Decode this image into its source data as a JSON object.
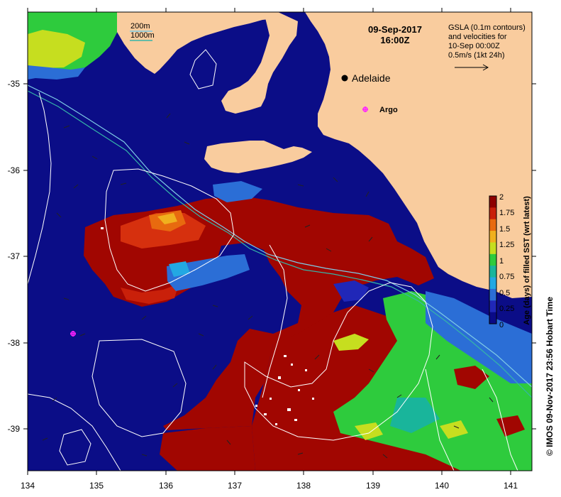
{
  "title": {
    "date": "09-Sep-2017",
    "time": "16:00Z"
  },
  "depth_legend": {
    "contour_1": "200m",
    "contour_2": "1000m",
    "colors": {
      "contour_1": "#7ecbe6",
      "contour_2": "#35b5a8"
    }
  },
  "gsla_note": {
    "line1": "GSLA (0.1m contours)",
    "line2": "and velocities for",
    "line3": "10-Sep 00:00Z",
    "line4": "0.5m/s (1kt 24h)"
  },
  "places": [
    {
      "name": "Adelaide",
      "marker": "black-dot",
      "lon": 138.6,
      "lat": -34.93
    },
    {
      "name": "Argo",
      "marker": "magenta-star",
      "lon": 138.9,
      "lat": -35.27
    }
  ],
  "argo_floats": [
    {
      "lon": 138.9,
      "lat": -35.27,
      "labeled": true
    },
    {
      "lon": 134.65,
      "lat": -37.9,
      "labeled": false
    }
  ],
  "axes": {
    "lon_min": 134.0,
    "lon_max": 141.3,
    "lat_max": -34.4,
    "lat_min": -39.48,
    "x_ticks": [
      "134",
      "135",
      "136",
      "137",
      "138",
      "139",
      "140",
      "141"
    ],
    "y_ticks": [
      "-35",
      "-36",
      "-37",
      "-38",
      "-39"
    ]
  },
  "colorbar": {
    "label": "Age (days) of filled SST (wrt latest)",
    "tick_labels": [
      "2",
      "1.75",
      "1.5",
      "1.25",
      "1",
      "0.75",
      "0.5",
      "0.25",
      "0"
    ],
    "min": 0,
    "max": 2,
    "colors_top_to_bottom": [
      "#8e0000",
      "#c9200a",
      "#e86a0f",
      "#f0b01e",
      "#c6de1f",
      "#2ecb3d",
      "#19b59b",
      "#23a8e3",
      "#2b6ed6",
      "#2027b8",
      "#0a0a87"
    ]
  },
  "credit": "© IMOS 09-Nov-2017 23:56 Hobart Time",
  "colors": {
    "land": "#f9cc9e",
    "sea_old": "#0b0d87",
    "sea_recent": "#a10601",
    "contour": "#ffffff"
  }
}
